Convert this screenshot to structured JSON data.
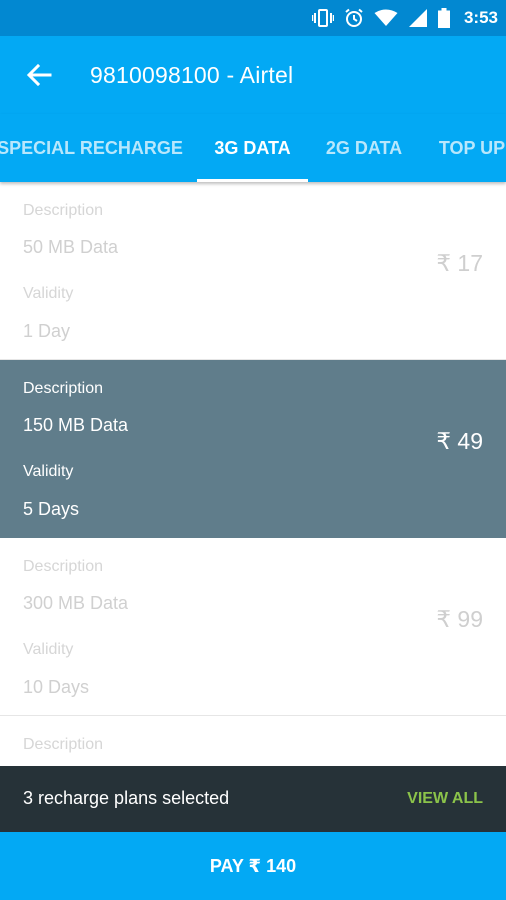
{
  "status_bar": {
    "time": "3:53",
    "icons": [
      "vibrate-icon",
      "alarm-icon",
      "wifi-icon",
      "signal-icon",
      "battery-icon"
    ]
  },
  "app_bar": {
    "title": "9810098100 - Airtel"
  },
  "tabs": [
    {
      "label": "SPECIAL RECHARGE",
      "active": false
    },
    {
      "label": "3G DATA",
      "active": true
    },
    {
      "label": "2G DATA",
      "active": false
    },
    {
      "label": "TOP UP",
      "active": false
    }
  ],
  "plans": [
    {
      "description_label": "Description",
      "description": "50 MB Data",
      "validity_label": "Validity",
      "validity": "1 Day",
      "price": "₹ 17",
      "selected": false
    },
    {
      "description_label": "Description",
      "description": "150 MB Data",
      "validity_label": "Validity",
      "validity": "5 Days",
      "price": "₹ 49",
      "selected": true
    },
    {
      "description_label": "Description",
      "description": "300 MB Data",
      "validity_label": "Validity",
      "validity": "10 Days",
      "price": "₹ 99",
      "selected": false
    },
    {
      "description_label": "Description"
    }
  ],
  "snackbar": {
    "message": "3 recharge plans selected",
    "action": "VIEW ALL"
  },
  "pay_button": {
    "label": "PAY ₹ 140"
  },
  "colors": {
    "primary": "#03a9f4",
    "primary_dark": "#0288d1",
    "selected_row": "#607d8b",
    "snackbar_bg": "#263238",
    "snackbar_action": "#8bc34a"
  }
}
